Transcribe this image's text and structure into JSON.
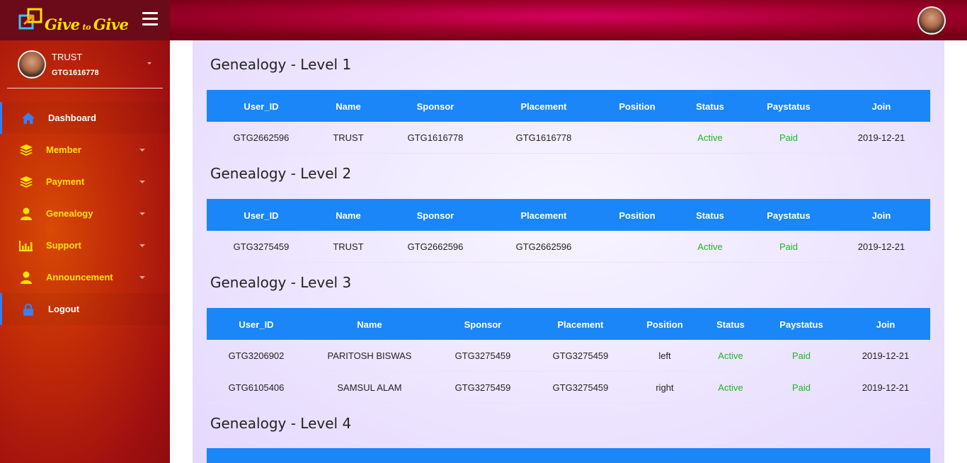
{
  "brand": {
    "logo_main": "Give",
    "logo_small": "to",
    "logo_end": "Give"
  },
  "profile": {
    "name": "TRUST",
    "id": "GTG1616778"
  },
  "menu": [
    {
      "label": "Dashboard",
      "icon": "home-icon"
    },
    {
      "label": "Member",
      "icon": "layers-icon"
    },
    {
      "label": "Payment",
      "icon": "layers-icon"
    },
    {
      "label": "Genealogy",
      "icon": "user-icon"
    },
    {
      "label": "Support",
      "icon": "bar-chart-icon"
    },
    {
      "label": "Announcement",
      "icon": "user-icon"
    },
    {
      "label": "Logout",
      "icon": "lock-icon"
    }
  ],
  "headers_a": [
    "User_ID",
    "Name",
    "Sponsor",
    "Placement",
    "Position",
    "Status",
    "Paystatus",
    "Join"
  ],
  "levels": [
    {
      "title": "Genealogy - Level 1",
      "rows": [
        {
          "user_id": "GTG2662596",
          "name": "TRUST",
          "sponsor": "GTG1616778",
          "placement": "GTG1616778",
          "position": "",
          "status": "Active",
          "paystatus": "Paid",
          "join": "2019-12-21"
        }
      ]
    },
    {
      "title": "Genealogy - Level 2",
      "rows": [
        {
          "user_id": "GTG3275459",
          "name": "TRUST",
          "sponsor": "GTG2662596",
          "placement": "GTG2662596",
          "position": "",
          "status": "Active",
          "paystatus": "Paid",
          "join": "2019-12-21"
        }
      ]
    },
    {
      "title": "Genealogy - Level 3",
      "rows": [
        {
          "user_id": "GTG3206902",
          "name": "PARITOSH BISWAS",
          "sponsor": "GTG3275459",
          "placement": "GTG3275459",
          "position": "left",
          "status": "Active",
          "paystatus": "Paid",
          "join": "2019-12-21"
        },
        {
          "user_id": "GTG6105406",
          "name": "SAMSUL ALAM",
          "sponsor": "GTG3275459",
          "placement": "GTG3275459",
          "position": "right",
          "status": "Active",
          "paystatus": "Paid",
          "join": "2019-12-21"
        }
      ]
    },
    {
      "title": "Genealogy - Level 4",
      "rows": []
    }
  ],
  "colors": {
    "accent": "#1a86f7",
    "status_green": "#22b422",
    "link": "#1a76d8",
    "menu_yellow": "#ffe400"
  }
}
